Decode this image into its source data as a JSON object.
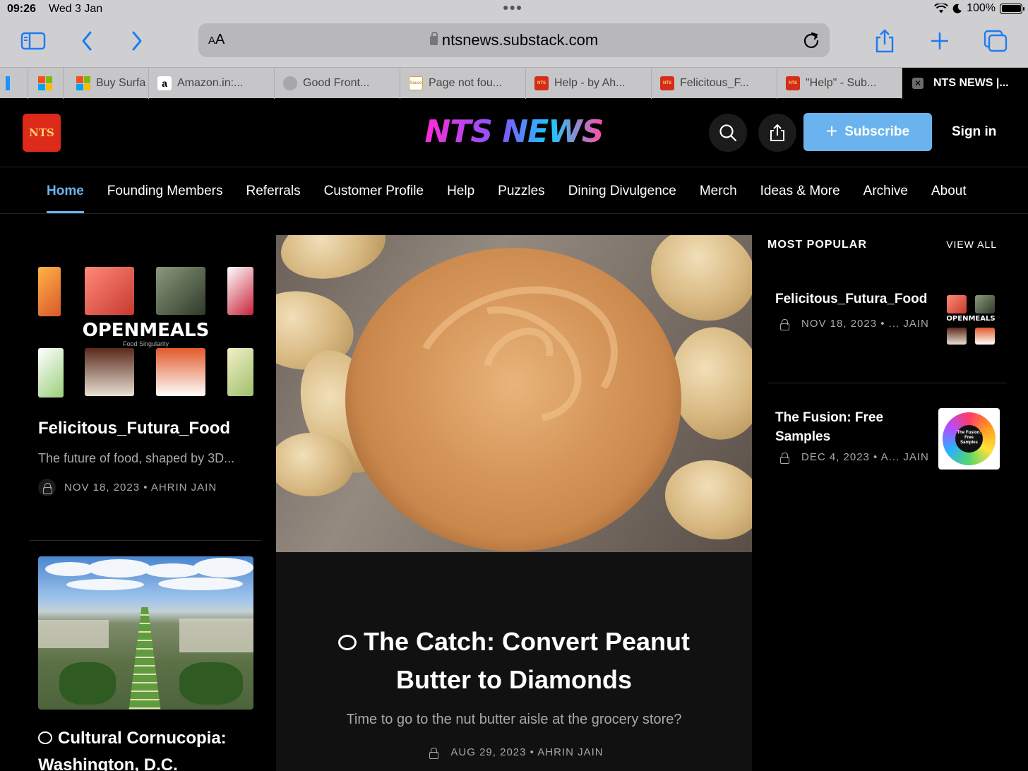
{
  "status_bar": {
    "time": "09:26",
    "date": "Wed 3 Jan",
    "battery": "100%"
  },
  "browser": {
    "aa_label": "A",
    "aa_label_big": "A",
    "url": "ntsnews.substack.com",
    "tabs": [
      {
        "label": "",
        "favicon": "microsoft"
      },
      {
        "label": "Buy Surfa",
        "favicon": "microsoft"
      },
      {
        "label": "Amazon.in:...",
        "favicon": "amazon"
      },
      {
        "label": "Good Front...",
        "favicon": "globe"
      },
      {
        "label": "Page not fou...",
        "favicon": "sauce"
      },
      {
        "label": "Help - by Ah...",
        "favicon": "nts"
      },
      {
        "label": "Felicitous_F...",
        "favicon": "nts"
      },
      {
        "label": "\"Help\" - Sub...",
        "favicon": "nts"
      },
      {
        "label": "NTS NEWS |...",
        "favicon": "close",
        "active": true
      }
    ]
  },
  "site": {
    "logo_text": "NTS",
    "wordmark": "NTS NEWS",
    "subscribe_label": "Subscribe",
    "signin_label": "Sign in",
    "accent": "#6ab3ee"
  },
  "nav": [
    {
      "label": "Home",
      "active": true
    },
    {
      "label": "Founding Members"
    },
    {
      "label": "Referrals"
    },
    {
      "label": "Customer Profile"
    },
    {
      "label": "Help"
    },
    {
      "label": "Puzzles"
    },
    {
      "label": "Dining Divulgence"
    },
    {
      "label": "Merch"
    },
    {
      "label": "Ideas & More"
    },
    {
      "label": "Archive"
    },
    {
      "label": "About"
    }
  ],
  "left_posts": [
    {
      "image_text": "OPENMEALS",
      "image_subtext": "Food Singularity",
      "title": "Felicitous_Futura_Food",
      "subtitle": "The future of food, shaped by 3D...",
      "meta": "NOV 18, 2023 • AHRIN JAIN"
    },
    {
      "title": "Cultural Cornucopia: Washington, D.C."
    }
  ],
  "feature": {
    "title": "The Catch: Convert Peanut Butter to Diamonds",
    "subtitle": "Time to go to the nut butter aisle at the grocery store?",
    "meta": "AUG 29, 2023 • AHRIN JAIN"
  },
  "popular": {
    "heading": "MOST POPULAR",
    "view_all": "VIEW ALL",
    "items": [
      {
        "title": "Felicitous_Futura_Food",
        "meta": "NOV 18, 2023 • ... JAIN",
        "thumb_text": "OPENMEALS"
      },
      {
        "title": "The Fusion: Free Samples",
        "meta": "DEC 4, 2023 • A... JAIN",
        "thumb_text": "The Fusion: Free Samples"
      }
    ]
  }
}
